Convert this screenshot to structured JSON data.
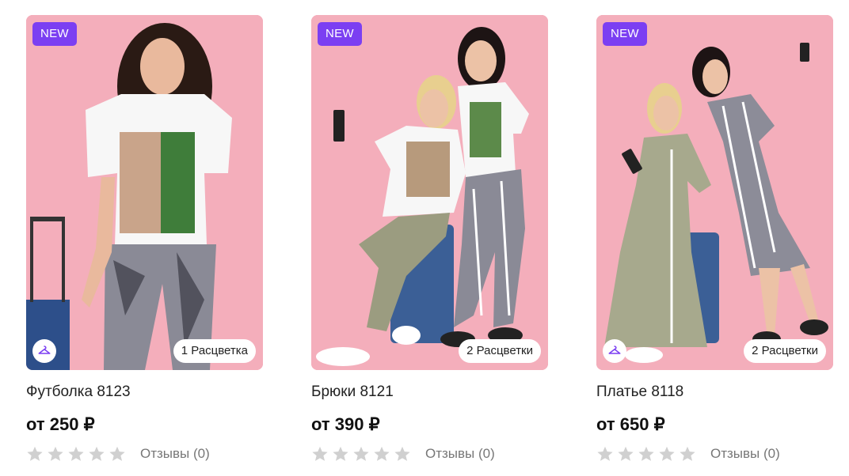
{
  "products": [
    {
      "badge": "NEW",
      "colors": "1 Расцветка",
      "title": "Футболка 8123",
      "price": "от 250 ₽",
      "reviews": "Отзывы (0)",
      "rating": 0,
      "has_hanger": true
    },
    {
      "badge": "NEW",
      "colors": "2 Расцветки",
      "title": "Брюки 8121",
      "price": "от 390 ₽",
      "reviews": "Отзывы (0)",
      "rating": 0,
      "has_hanger": false
    },
    {
      "badge": "NEW",
      "colors": "2 Расцветки",
      "title": "Платье 8118",
      "price": "от 650 ₽",
      "reviews": "Отзывы (0)",
      "rating": 0,
      "has_hanger": true
    }
  ],
  "colors": {
    "accent": "#7b3ff2",
    "photo_bg": "#f2a9b6",
    "star_empty": "#d0d0d0"
  },
  "icons": {
    "hanger": "hanger-icon",
    "star": "star-icon"
  }
}
